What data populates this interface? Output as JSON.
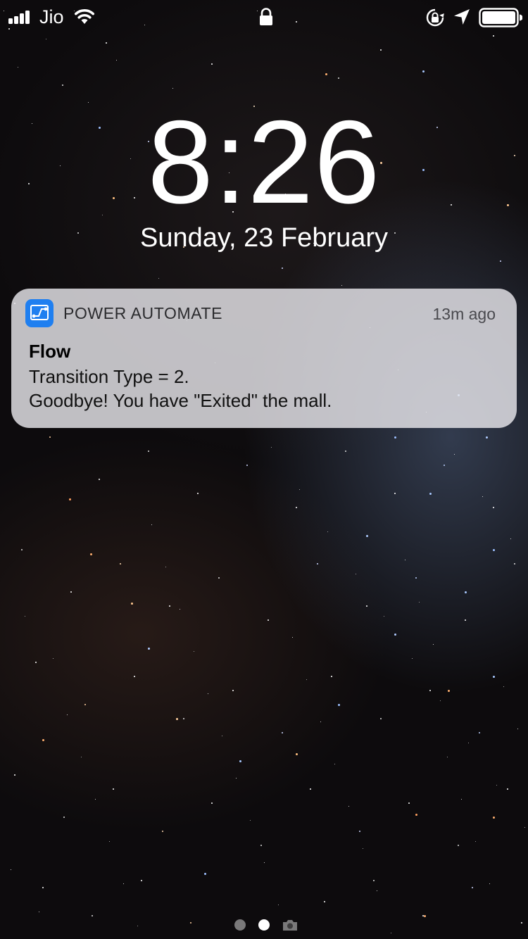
{
  "status_bar": {
    "carrier": "Jio",
    "signal_bars": 4,
    "wifi": "wifi-icon",
    "lock": "lock-icon",
    "orientation_lock": "rotation-lock-icon",
    "location": "location-arrow-icon",
    "battery": "battery-icon"
  },
  "lock_screen": {
    "time": "8:26",
    "date": "Sunday, 23 February"
  },
  "notification": {
    "app_name": "POWER AUTOMATE",
    "app_icon": "power-automate-icon",
    "app_color": "#1f7ff0",
    "timestamp": "13m ago",
    "title": "Flow",
    "body_lines": [
      "Transition Type = 2.",
      "Goodbye! You have \"Exited\" the mall."
    ]
  },
  "page_indicator": {
    "pages": 2,
    "current": 2,
    "trailing_icon": "camera-icon"
  }
}
